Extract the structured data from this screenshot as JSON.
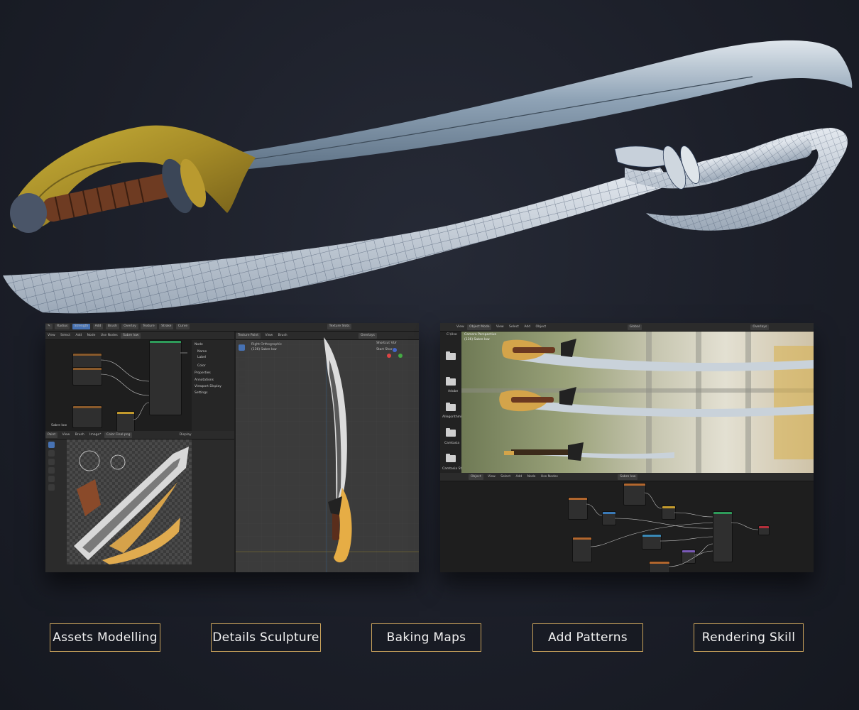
{
  "captions": [
    "Assets Modelling",
    "Details Sculpture",
    "Baking Maps",
    "Add Patterns",
    "Rendering Skill"
  ],
  "left_window": {
    "header": [
      "Radius",
      "Strength",
      "Add",
      "Brush",
      "Overlay",
      "Texture",
      "Stroke",
      "Curve",
      "Texture Slots"
    ],
    "node_menu": [
      "View",
      "Select",
      "Add",
      "Node",
      "Use Nodes"
    ],
    "node_tree": "Sabre low",
    "side_panel": [
      "Node",
      "Name",
      "Label",
      "Color",
      "Properties",
      "Annotations",
      "Viewport Display",
      "Settings"
    ],
    "image_header": [
      "Paint",
      "View",
      "Brush",
      "Image*",
      "Color Final.png",
      "Display"
    ],
    "viewport_header": [
      "Texture Paint",
      "View",
      "Brush",
      "Overlays",
      "Shortcut VUr",
      "Start Shor"
    ],
    "viewport_info": [
      "Right Orthographic",
      "(136) Sabre low"
    ]
  },
  "right_window": {
    "header": [
      "View",
      "Object Mode",
      "View",
      "Select",
      "Add",
      "Object",
      "Global",
      "Overlays"
    ],
    "file_sidebar": [
      "C:\\Use",
      "Adobe",
      "Allegorithmic",
      "Camtasia",
      "Camtasia Stu"
    ],
    "viewport_info": [
      "Camera Perspective",
      "(136) Sabre low"
    ],
    "node_menu": [
      "Object",
      "View",
      "Select",
      "Add",
      "Node",
      "Use Nodes",
      "Sabre low"
    ]
  },
  "colors": {
    "caption_border": "#c9a25b",
    "accent": "#4772b3",
    "background": "#1c1f29"
  }
}
